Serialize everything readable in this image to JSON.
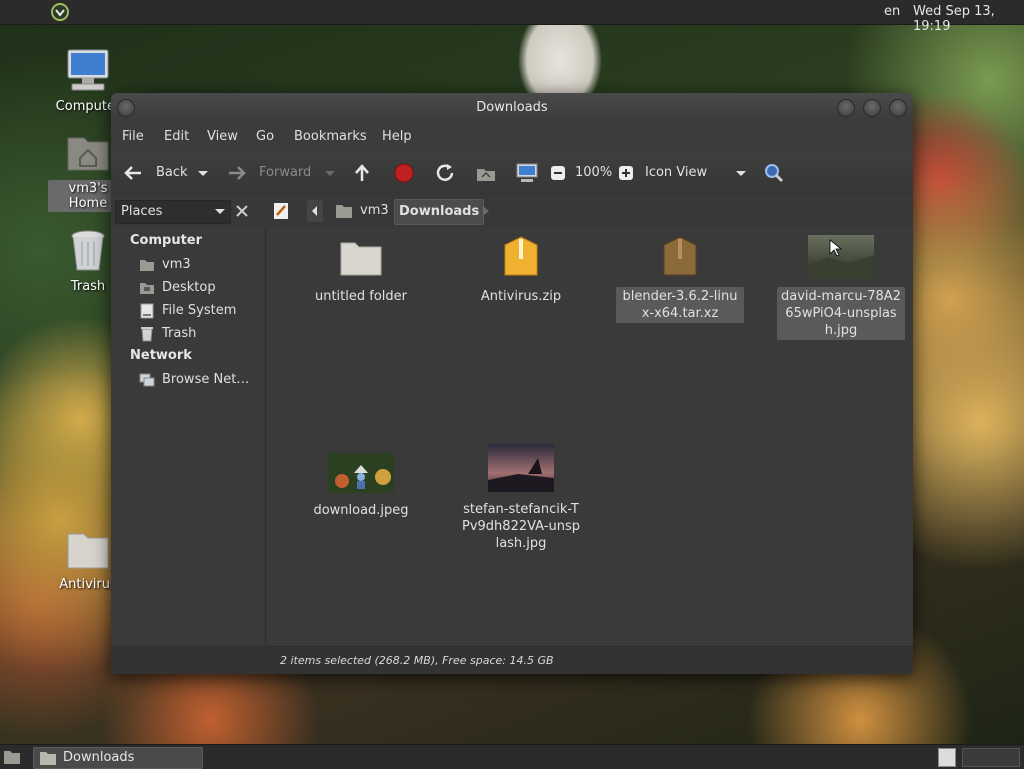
{
  "topbar": {
    "menu_icon": "distro-logo-icon",
    "lang": "en",
    "clock": "Wed Sep 13, 19:19"
  },
  "desktop": {
    "icons": [
      {
        "label": "Computer",
        "icon": "computer-icon"
      },
      {
        "label": "vm3's Home",
        "icon": "home-folder-icon"
      },
      {
        "label": "Trash",
        "icon": "trash-icon"
      },
      {
        "label": "Antivirus",
        "icon": "folder-icon"
      }
    ]
  },
  "window": {
    "title": "Downloads",
    "menu": [
      "File",
      "Edit",
      "View",
      "Go",
      "Bookmarks",
      "Help"
    ],
    "toolbar": {
      "back": "Back",
      "forward": "Forward",
      "zoom": "100%",
      "view_mode": "Icon View"
    },
    "location": {
      "places_label": "Places",
      "crumbs": [
        "vm3",
        "Downloads"
      ]
    },
    "sidebar": {
      "computer_header": "Computer",
      "computer_items": [
        {
          "label": "vm3",
          "icon": "home-icon"
        },
        {
          "label": "Desktop",
          "icon": "desktop-folder-icon"
        },
        {
          "label": "File System",
          "icon": "drive-icon"
        },
        {
          "label": "Trash",
          "icon": "trash-icon"
        }
      ],
      "network_header": "Network",
      "network_items": [
        {
          "label": "Browse Net…",
          "icon": "network-icon"
        }
      ]
    },
    "files": [
      {
        "name": "untitled folder",
        "type": "folder",
        "selected": false
      },
      {
        "name": "Antivirus.zip",
        "type": "zip",
        "selected": false
      },
      {
        "name": "blender-3.6.2-linux-x64.tar.xz",
        "type": "archive",
        "selected": true
      },
      {
        "name": "david-marcu-78A265wPiO4-unsplash.jpg",
        "type": "image",
        "selected": true
      },
      {
        "name": "download.jpeg",
        "type": "image",
        "selected": false
      },
      {
        "name": "stefan-stefancik-TPv9dh822VA-unsplash.jpg",
        "type": "image",
        "selected": false
      }
    ],
    "status": "2 items selected (268.2 MB), Free space: 14.5 GB"
  },
  "taskbar": {
    "task_label": "Downloads"
  }
}
